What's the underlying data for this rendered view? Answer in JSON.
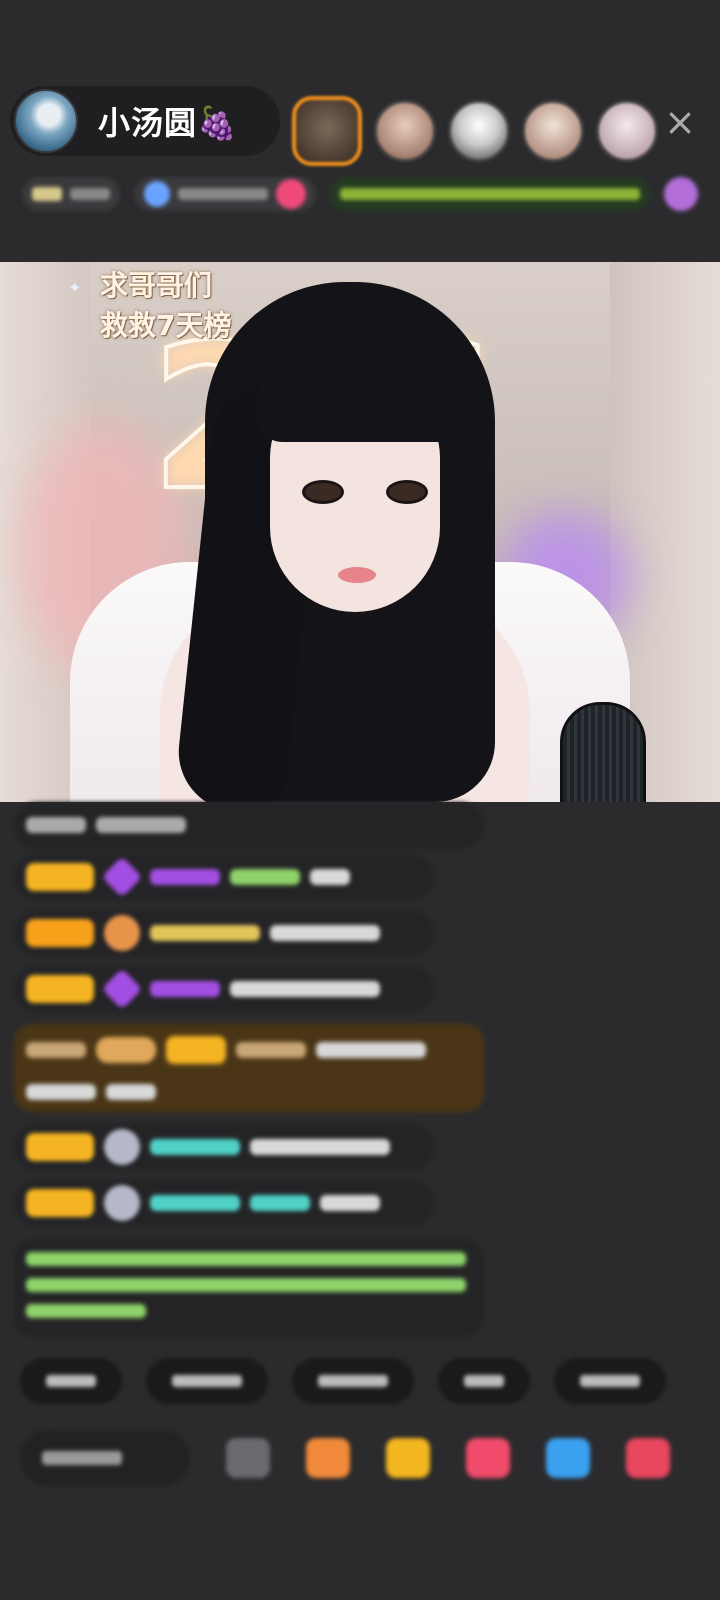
{
  "header": {
    "host_name": "小汤圆🍇",
    "close_icon": "×"
  },
  "video": {
    "overlay_line1": "求哥哥们",
    "overlay_line2": "救救7天榜",
    "neon_text": "2 6"
  },
  "colors": {
    "background": "#2b2b2d",
    "badge_gold": "#f5b423",
    "nick_purple": "#a34ee2",
    "nick_green": "#8fd36a",
    "nick_cyan": "#4fd1c5",
    "system_text": "#8fd36a",
    "gift_bg": "#4a3516"
  },
  "icons": {
    "close": "close-icon",
    "grape": "grape-emoji",
    "sparkle": "sparkle-icon"
  }
}
